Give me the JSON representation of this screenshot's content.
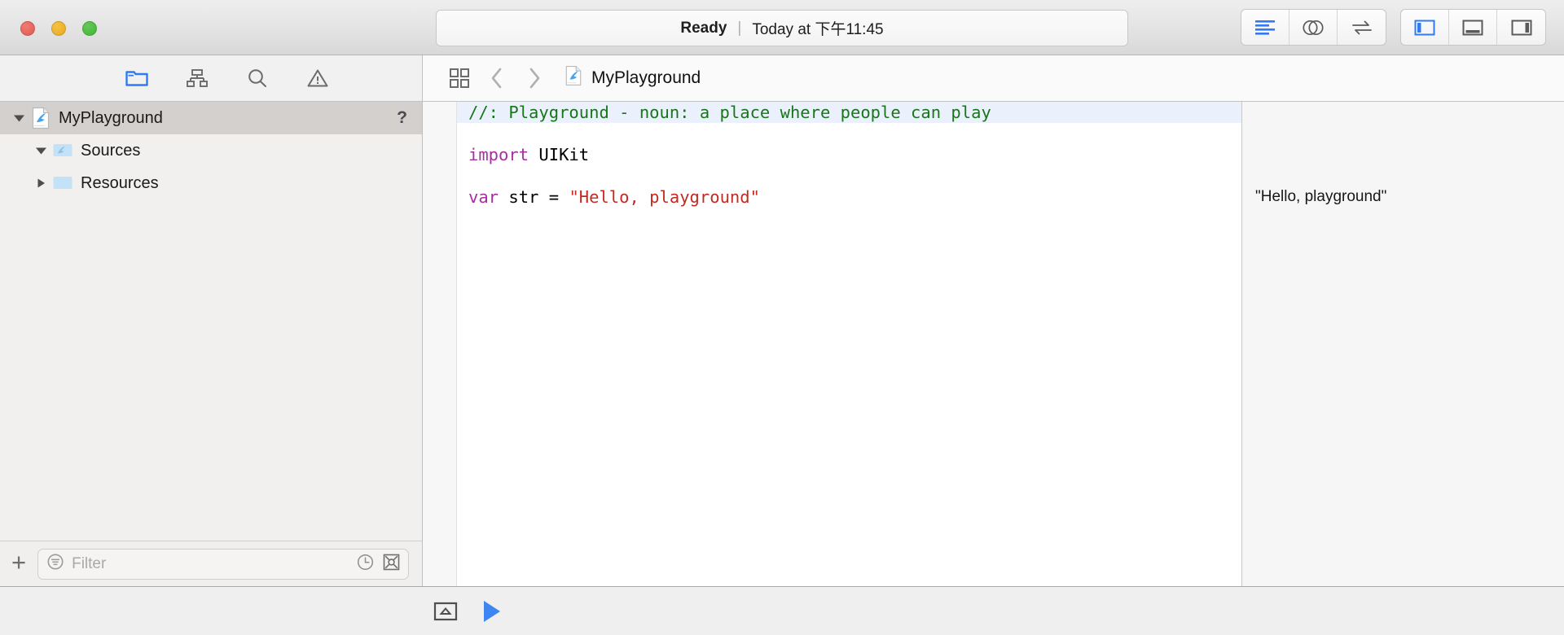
{
  "window": {
    "traffic_lights": [
      {
        "name": "close",
        "color": "#e05a4f"
      },
      {
        "name": "minimize",
        "color": "#e8aa1f"
      },
      {
        "name": "maximize",
        "color": "#3fb62f"
      }
    ]
  },
  "toolbar": {
    "status": {
      "state": "Ready",
      "separator": "|",
      "time": "Today at 下午11:45"
    },
    "editor_mode_buttons": [
      {
        "name": "standard-editor",
        "icon": "lines-icon",
        "active": true
      },
      {
        "name": "assistant-editor",
        "icon": "venn-circles-icon",
        "active": false
      },
      {
        "name": "version-editor",
        "icon": "swap-arrows-icon",
        "active": false
      }
    ],
    "panel_toggle_buttons": [
      {
        "name": "navigator-toggle",
        "icon": "left-panel-icon",
        "active": true
      },
      {
        "name": "debug-toggle",
        "icon": "bottom-panel-icon",
        "active": false
      },
      {
        "name": "utilities-toggle",
        "icon": "right-panel-icon",
        "active": false
      }
    ],
    "accent_color": "#307af2"
  },
  "navigator": {
    "tabs": [
      {
        "name": "project-navigator",
        "icon": "folder-icon",
        "active": true
      },
      {
        "name": "symbol-navigator",
        "icon": "hierarchy-icon",
        "active": false
      },
      {
        "name": "find-navigator",
        "icon": "search-icon",
        "active": false
      },
      {
        "name": "issue-navigator",
        "icon": "warning-icon",
        "active": false
      }
    ],
    "tree": [
      {
        "label": "MyPlayground",
        "icon": "swift-playground-file-icon",
        "twisty": "down",
        "indent": 1,
        "selected": true,
        "badge": "?"
      },
      {
        "label": "Sources",
        "icon": "swift-folder-icon",
        "twisty": "down",
        "indent": 2,
        "selected": false,
        "badge": ""
      },
      {
        "label": "Resources",
        "icon": "folder-blue-icon",
        "twisty": "right",
        "indent": 2,
        "selected": false,
        "badge": ""
      }
    ],
    "bottom_bar": {
      "add_label": "+",
      "filter_placeholder": "Filter",
      "filter_value": "",
      "icons": [
        {
          "name": "filter-icon"
        },
        {
          "name": "recent-clock-icon"
        },
        {
          "name": "source-control-icon"
        }
      ]
    }
  },
  "jump_bar": {
    "related_items_icon": "grid-squares-icon",
    "back_icon": "chevron-left-icon",
    "forward_icon": "chevron-right-icon",
    "file_icon": "swift-playground-file-icon",
    "file_name": "MyPlayground"
  },
  "editor": {
    "lines": [
      {
        "current": true,
        "tokens": [
          {
            "text": "//: Playground - noun: a place where people can play",
            "type": "comment"
          }
        ]
      },
      {
        "current": false,
        "tokens": []
      },
      {
        "current": false,
        "tokens": [
          {
            "text": "import",
            "type": "keyword"
          },
          {
            "text": " UIKit",
            "type": "plain"
          }
        ]
      },
      {
        "current": false,
        "tokens": []
      },
      {
        "current": false,
        "tokens": [
          {
            "text": "var",
            "type": "keyword"
          },
          {
            "text": " str = ",
            "type": "plain"
          },
          {
            "text": "\"Hello, playground\"",
            "type": "string"
          }
        ]
      }
    ],
    "syntax_colors": {
      "comment": "#197519",
      "keyword": "#a72ea1",
      "plain": "#000000",
      "string": "#c32b21",
      "current_line_background": "#eaf1fd"
    }
  },
  "results": [
    {
      "line_index": 4,
      "value": "\"Hello, playground\""
    }
  ],
  "debug_bar": {
    "buttons": [
      {
        "name": "toggle-console-button",
        "icon": "console-panel-icon"
      },
      {
        "name": "execute-playground-button",
        "icon": "play-triangle-icon"
      }
    ]
  }
}
